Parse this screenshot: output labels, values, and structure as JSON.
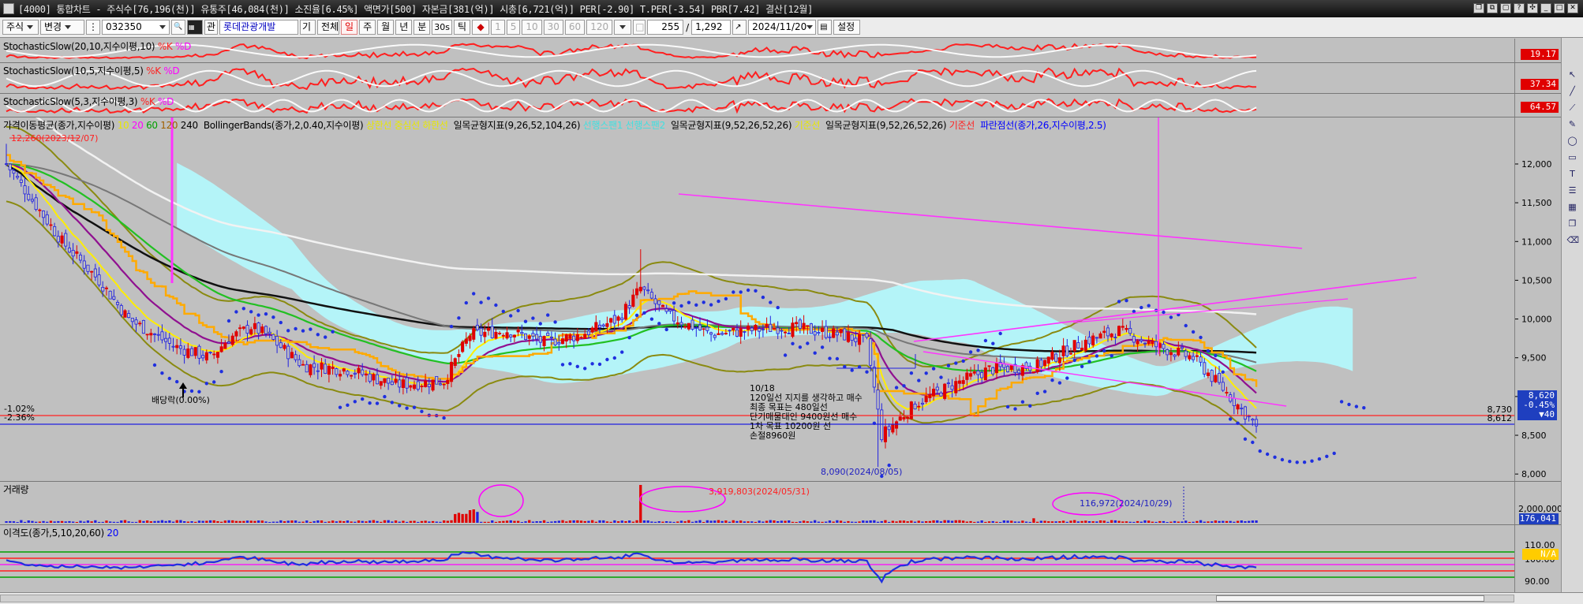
{
  "window": {
    "title": "[4000] 통합차트 - 주식수[76,196(천)] 유통주[46,084(천)] 소진율[6.45%] 액면가[500] 자본금[381(억)] 시총[6,721(억)] PER[-2.90] T.PER[-3.54] PBR[7.42] 결산[12월]"
  },
  "toolbar": {
    "mode": "주식",
    "change": "변경",
    "code": "032350",
    "rel_label": "관",
    "stock_name": "롯데관광개발",
    "period_label": "기",
    "all_label": "전체",
    "tabs": [
      "일",
      "주",
      "월",
      "년",
      "분",
      "30s",
      "틱"
    ],
    "active_tab": "일",
    "minute_opts": [
      "1",
      "5",
      "10",
      "30",
      "60",
      "120"
    ],
    "count": "255",
    "total": "1,292",
    "date": "2024/11/20",
    "settings": "설정"
  },
  "colors": {
    "up_candle": "#e00000",
    "down_candle": "#2020e0",
    "cloud": "#b4f4f8",
    "trend": "#ff33ff",
    "ma_black": "#111111",
    "ma_white": "#f2f2f2",
    "bollinger": "#8a8a10",
    "ichimoku_base": "#ffaa00"
  },
  "panels": {
    "stoch1": {
      "name": "StochasticSlow(20,10,지수이평,10)",
      "k": "%K",
      "d": "%D",
      "value": "19.17"
    },
    "stoch2": {
      "name": "StochasticSlow(10,5,지수이평,5)",
      "k": "%K",
      "d": "%D",
      "value": "37.34"
    },
    "stoch3": {
      "name": "StochasticSlow(5,3,지수이평,3)",
      "k": "%K",
      "d": "%D",
      "value": "64.57"
    },
    "price": {
      "legend_ma": "가격이동평균(종가,지수이평)",
      "ma_periods": [
        "10",
        "20",
        "60",
        "120",
        "240"
      ],
      "legend_bb": "BollingerBands(종가,2,0.40,지수이평)",
      "bb_lines": "상한선 중심선 하한선",
      "legend_ichi1": "일목균형지표(9,26,52,104,26)",
      "ichi1_lines": "선행스팬1 선행스팬2",
      "legend_ichi2": "일목균형지표(9,52,26,52,26)",
      "ichi2_lines": "기준선",
      "legend_ichi3": "일목균형지표(9,52,26,52,26)",
      "ichi3_lines": "기준선",
      "legend_psar": "파란점선(종가,26,지수이평,2.5)",
      "high_label": "12,260(2023/12/07)",
      "low_label": "8,090(2024/08/05)",
      "dividend_label": "배당락(0.00%)",
      "pct1": "-1.02%",
      "pct2": "-2.36%",
      "ref1": "8,730",
      "ref2": "8,612",
      "current": "8,620",
      "change_pct": "-0.45%",
      "change_abs": "▼40",
      "memo": [
        "10/18",
        "120일선 지지를 생각하고 매수",
        "최종 목표는 480일선",
        "단기매물대인 9400원선 매수",
        "1차 목표 10200원 선",
        "손절8960원"
      ]
    },
    "volume": {
      "name": "거래량",
      "max_label": "3,919,803(2024/05/31)",
      "mark_label": "116,972(2024/10/29)",
      "current": "176,041",
      "ticks": [
        "2,000,000"
      ]
    },
    "disparity": {
      "name": "이격도(종가,5,10,20,60)",
      "period": "20",
      "current": "N/A",
      "ticks": [
        "110.00",
        "100.00",
        "90.00"
      ]
    }
  },
  "chart_data": {
    "type": "candlestick",
    "title": "롯데관광개발 032350 일봉",
    "ylim": [
      7900,
      12600
    ],
    "y_ticks": [
      8000,
      8500,
      9000,
      9500,
      10000,
      10500,
      11000,
      11500,
      12000
    ],
    "y_tick_labels": [
      "8,000",
      "8,500",
      "9,000",
      "9,500",
      "10,000",
      "10,500",
      "11,000",
      "11,500",
      "12,000"
    ],
    "close_keypoints": [
      [
        0,
        12000
      ],
      [
        6,
        11600
      ],
      [
        15,
        11000
      ],
      [
        25,
        10500
      ],
      [
        33,
        10000
      ],
      [
        45,
        9650
      ],
      [
        55,
        9500
      ],
      [
        60,
        9750
      ],
      [
        66,
        9900
      ],
      [
        70,
        9800
      ],
      [
        80,
        9400
      ],
      [
        92,
        9350
      ],
      [
        105,
        9150
      ],
      [
        118,
        9200
      ],
      [
        125,
        9800
      ],
      [
        135,
        9850
      ],
      [
        145,
        9700
      ],
      [
        155,
        9800
      ],
      [
        165,
        10000
      ],
      [
        171,
        10400
      ],
      [
        178,
        10050
      ],
      [
        190,
        9800
      ],
      [
        210,
        9900
      ],
      [
        225,
        9800
      ],
      [
        232,
        9700
      ],
      [
        236,
        8500
      ],
      [
        245,
        8900
      ],
      [
        255,
        9150
      ],
      [
        265,
        9350
      ],
      [
        278,
        9400
      ],
      [
        290,
        9700
      ],
      [
        300,
        9850
      ],
      [
        310,
        9650
      ],
      [
        320,
        9500
      ],
      [
        328,
        9100
      ],
      [
        337,
        8620
      ]
    ],
    "bar_count": 338,
    "sample_highs": [
      [
        "2023/12/07",
        12260
      ],
      [
        "2024/05/31",
        10900
      ]
    ],
    "sample_lows": [
      [
        "2024/08/05",
        8090
      ]
    ],
    "last_close": 8620,
    "ma_series": [
      "10",
      "20",
      "60",
      "120",
      "240"
    ],
    "volume_spike": {
      "date": "2024/05/31",
      "value": 3919803
    },
    "volume_mark": {
      "date": "2024/10/29",
      "value": 116972
    },
    "disparity_range": [
      88,
      112
    ]
  }
}
